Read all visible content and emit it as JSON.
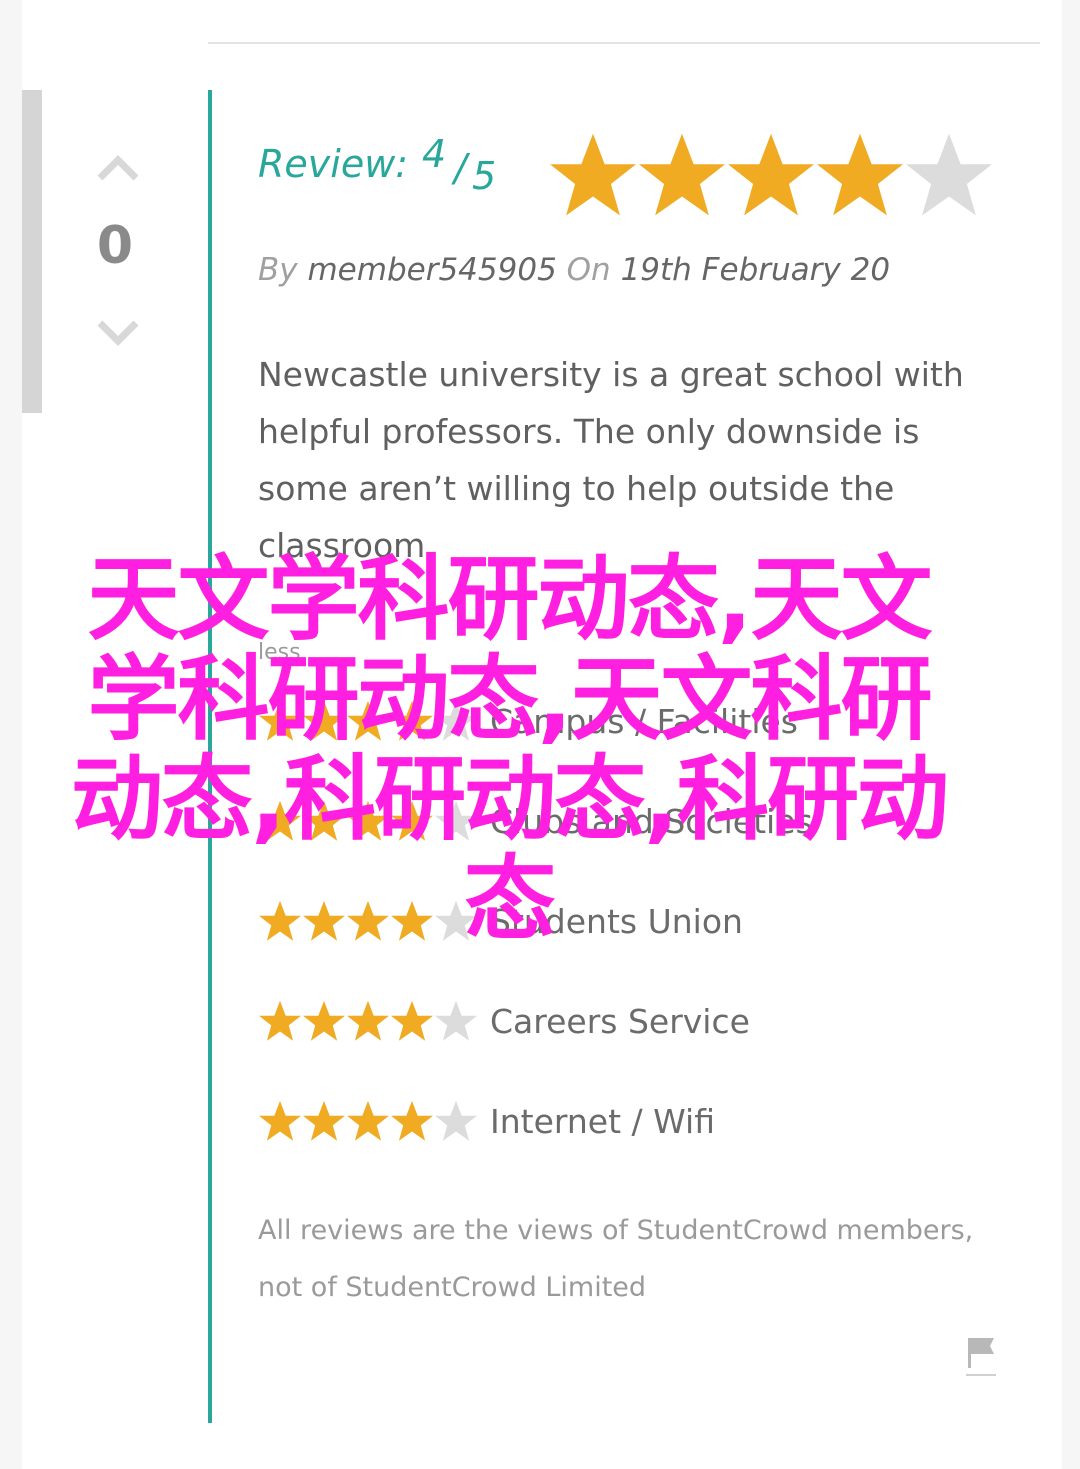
{
  "colors": {
    "accent": "#2aa79b",
    "star_on": "#f0ab23",
    "star_off": "#dcdcdc",
    "overlay": "#ff1fe0"
  },
  "vote": {
    "count": "0",
    "up_icon": "chevron-up-icon",
    "down_icon": "chevron-down-icon"
  },
  "review": {
    "label": "Review:",
    "score": "4",
    "slash": "/",
    "max": "5",
    "rating": 4,
    "by_label": "By",
    "author": "member545905",
    "on_label": "On",
    "date": "19th February 20",
    "body": "Newcastle university is a great school with helpful professors. The only downside is some aren’t willing to help outside the classroom",
    "less_label": "less"
  },
  "ratings": [
    {
      "label": "Campus / Facilities",
      "stars": 4
    },
    {
      "label": "Clubs and Societies",
      "stars": 4
    },
    {
      "label": "Students Union",
      "stars": 4
    },
    {
      "label": "Careers Service",
      "stars": 4
    },
    {
      "label": "Internet / Wifi",
      "stars": 4
    }
  ],
  "disclaimer": "All reviews are the views of StudentCrowd members, not of StudentCrowd Limited",
  "flag_icon": "flag-icon",
  "overlay_text": "天文学科研动态,天文学科研动态,天文科研动态,科研动态,科研动态"
}
